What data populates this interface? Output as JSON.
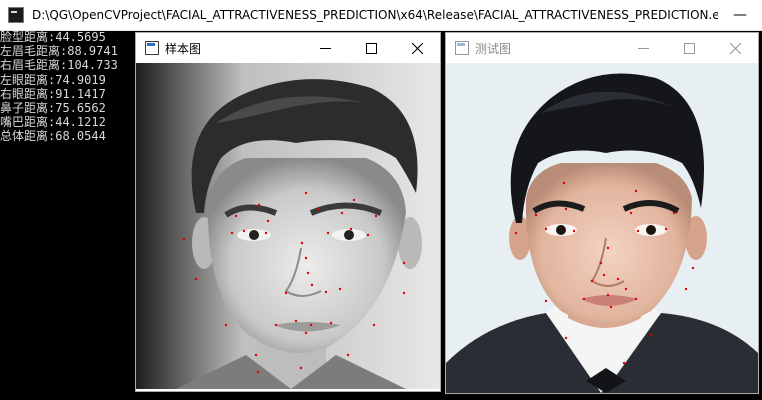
{
  "console": {
    "title": "D:\\QG\\OpenCVProject\\FACIAL_ATTRACTIVENESS_PREDICTION\\x64\\Release\\FACIAL_ATTRACTIVENESS_PREDICTION.e...",
    "minimize_glyph": "—",
    "lines": [
      "脸型距离:44.5695",
      "左眉毛距离:88.9741",
      "右眉毛距离:104.733",
      "左眼距离:74.9019",
      "右眼距离:91.1417",
      "鼻子距离:75.6562",
      "嘴巴距离:44.1212",
      "总体距离:68.0544"
    ]
  },
  "sample_window": {
    "title": "样本图",
    "active": true
  },
  "test_window": {
    "title": "测试图",
    "active": false
  }
}
